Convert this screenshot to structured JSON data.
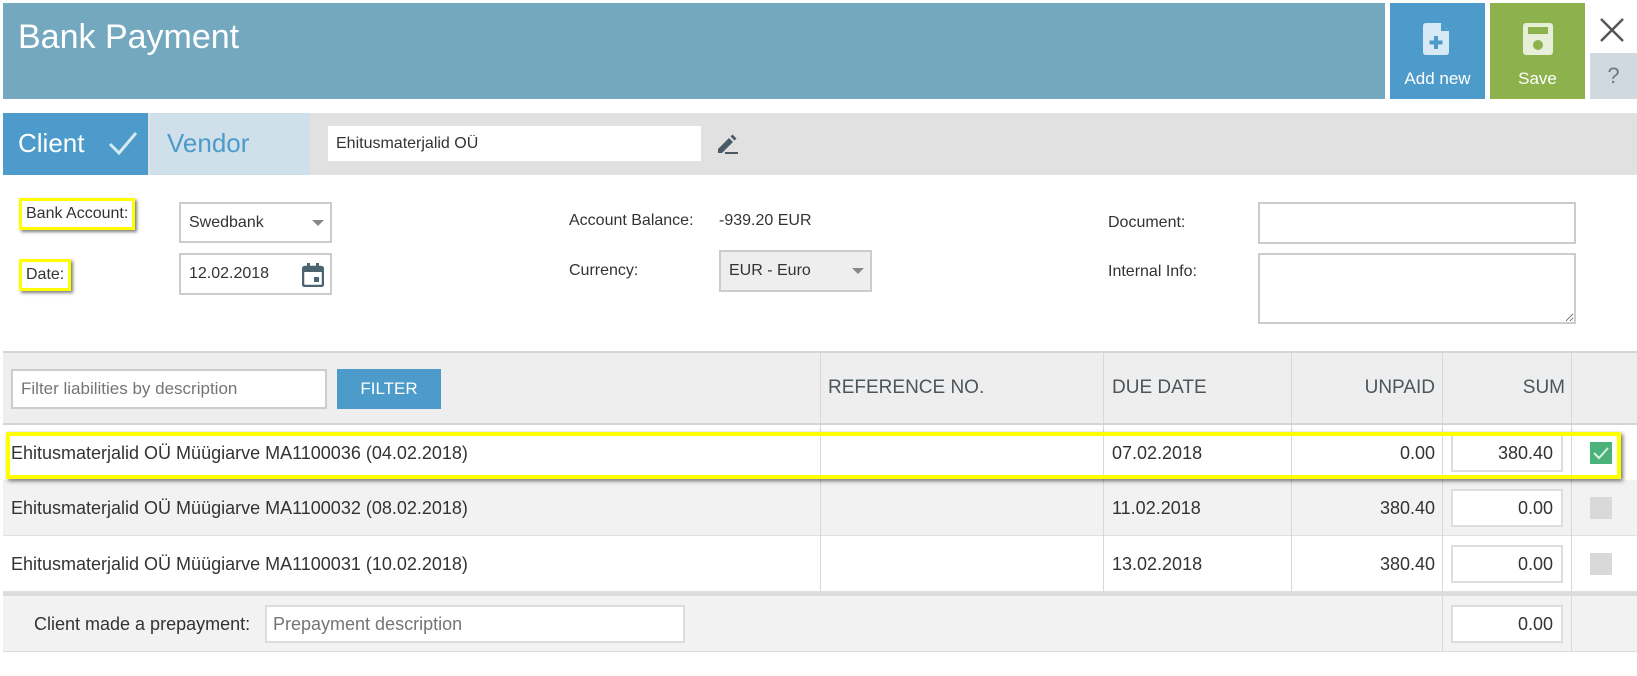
{
  "header": {
    "title": "Bank Payment",
    "add_new_label": "Add new",
    "save_label": "Save",
    "help_label": "?",
    "colors": {
      "header_bg": "#73a8bf",
      "add_new_bg": "#4d9bca",
      "save_bg": "#8db14d"
    }
  },
  "tabs": {
    "client_label": "Client",
    "vendor_label": "Vendor",
    "active": "Client",
    "partner_value": "Ehitusmaterjalid OÜ"
  },
  "form": {
    "bank_account_label": "Bank Account:",
    "bank_account_value": "Swedbank",
    "date_label": "Date:",
    "date_value": "12.02.2018",
    "account_balance_label": "Account Balance:",
    "account_balance_value": "-939.20 EUR",
    "currency_label": "Currency:",
    "currency_value": "EUR - Euro",
    "document_label": "Document:",
    "document_value": "",
    "internal_info_label": "Internal Info:",
    "internal_info_value": ""
  },
  "table": {
    "filter_placeholder": "Filter liabilities by description",
    "filter_button": "FILTER",
    "columns": {
      "reference": "REFERENCE NO.",
      "due_date": "DUE DATE",
      "unpaid": "UNPAID",
      "sum": "SUM"
    },
    "rows": [
      {
        "description": "Ehitusmaterjalid OÜ Müügiarve MA1100036 (04.02.2018)",
        "reference": "",
        "due_date": "07.02.2018",
        "unpaid": "0.00",
        "sum": "380.40",
        "checked": true
      },
      {
        "description": "Ehitusmaterjalid OÜ Müügiarve MA1100032 (08.02.2018)",
        "reference": "",
        "due_date": "11.02.2018",
        "unpaid": "380.40",
        "sum": "0.00",
        "checked": false
      },
      {
        "description": "Ehitusmaterjalid OÜ Müügiarve MA1100031 (10.02.2018)",
        "reference": "",
        "due_date": "13.02.2018",
        "unpaid": "380.40",
        "sum": "0.00",
        "checked": false
      }
    ],
    "prepayment": {
      "label": "Client made a prepayment:",
      "description_placeholder": "Prepayment description",
      "amount": "0.00"
    }
  }
}
